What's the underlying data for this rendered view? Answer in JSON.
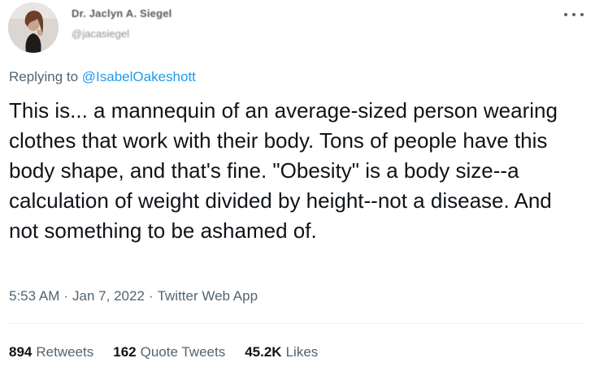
{
  "author": {
    "display_name": "Dr. Jaclyn A. Siegel",
    "handle": "@jacasiegel"
  },
  "reply": {
    "prefix": "Replying to",
    "mention": "@IsabelOakeshott"
  },
  "tweet": {
    "text": "This is... a mannequin of an average-sized person wearing clothes that work with their body. Tons of people have this body shape, and that's fine. \"Obesity\" is a body size--a calculation of weight divided by height--not a disease. And not something to be ashamed of.",
    "time": "5:53 AM",
    "date": "Jan 7, 2022",
    "source": "Twitter Web App",
    "separator": "·"
  },
  "stats": {
    "retweets_count": "894",
    "retweets_label": "Retweets",
    "quotes_count": "162",
    "quotes_label": "Quote Tweets",
    "likes_count": "45.2K",
    "likes_label": "Likes"
  },
  "icons": {
    "more": "more-horizontal-icon"
  }
}
